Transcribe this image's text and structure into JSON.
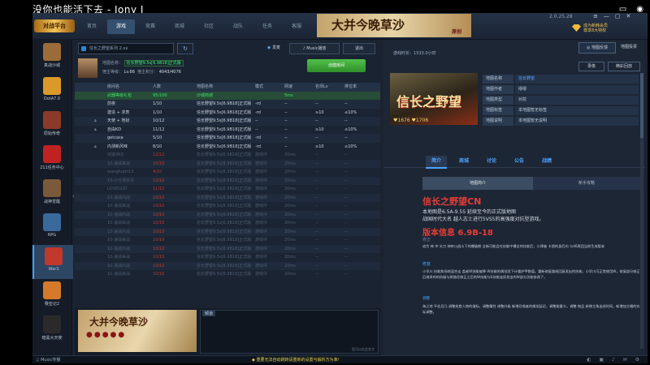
{
  "stream": {
    "title": "没你也能活下去 - Jony J"
  },
  "app": {
    "logo": "对战平台",
    "nav": [
      "首页",
      "游戏",
      "竞赛",
      "商城",
      "社区",
      "战队",
      "任务",
      "客服"
    ],
    "banner": "大并今晚草沙",
    "banner_seal": "原创",
    "version": "2.0.25.28",
    "window_controls": [
      "≡",
      "—",
      "▢",
      "✕"
    ],
    "vip": {
      "line1": "成为新韩会员",
      "line2": "尊享8大特权"
    }
  },
  "sidebar": {
    "items": [
      {
        "label": "真战沙城",
        "color": "#9c6b3a"
      },
      {
        "label": "DotA7.0",
        "color": "#d99a2a"
      },
      {
        "label": "原始传奇",
        "color": "#8b3a2a"
      },
      {
        "label": "211任务中心",
        "color": "#c02222"
      },
      {
        "label": "战神觉醒",
        "color": "#7a5a3a"
      },
      {
        "label": "RPG",
        "color": "#3a6a9c"
      },
      {
        "label": "War3",
        "color": "#c0392b"
      },
      {
        "label": "赛亚记2",
        "color": "#d47a2a"
      },
      {
        "label": "暗黑大天使",
        "color": "#2a2a2a"
      }
    ],
    "active_index": 6
  },
  "room": {
    "search_placeholder": "信长之野望系列 2.xx",
    "refresh_icon": "↻",
    "buttons": {
      "voice": "发麦",
      "music": "Music播放",
      "exit": "退出"
    },
    "info": {
      "map_label": "地图名称：",
      "map_name": "信长野望9.5s[6.9B18]正式版",
      "host_label": "宿主等级：",
      "host_level": "Lv.66",
      "host_points_label": "宿主积分：",
      "host_points": "4043/4076"
    },
    "create_label": "创建房间"
  },
  "table": {
    "headers": [
      "房间名",
      "人数",
      "地图名称",
      "模式",
      "网速",
      "名师Lv",
      "排位率"
    ],
    "rows": [
      {
        "name": "武器等级礼包",
        "count": "95/100",
        "map": "沙城商城",
        "mode": "",
        "net": "5ms",
        "lv": "",
        "rate": "",
        "state": "sel",
        "lock": false
      },
      {
        "name": "前夜",
        "count": "1/10",
        "map": "信长野望9.5s[6.9B18]正式版",
        "mode": "-rd",
        "net": "--",
        "lv": "--",
        "rate": "--",
        "state": "odd",
        "lock": false
      },
      {
        "name": "建造 + 求表",
        "count": "1/10",
        "map": "信长野望9.5s[6.9B18]正式版",
        "mode": "-rd",
        "net": "--",
        "lv": "≥10",
        "rate": "≤10%",
        "state": "even",
        "lock": false
      },
      {
        "name": "天使 + 地狱",
        "count": "10/12",
        "map": "信长野望9.5s[6.9B18]正式版",
        "mode": "--",
        "net": "--",
        "lv": "--",
        "rate": "--",
        "state": "odd",
        "lock": true
      },
      {
        "name": "自由KD",
        "count": "11/12",
        "map": "信长野望9.5s[6.9B18]正式版",
        "mode": "--",
        "net": "--",
        "lv": "≥10",
        "rate": "≤10%",
        "state": "even",
        "lock": true
      },
      {
        "name": "getcasa",
        "count": "5/10",
        "map": "信长野望9.5s[6.9B18]正式版",
        "mode": "-rd",
        "net": "--",
        "lv": "--",
        "rate": "--",
        "state": "odd",
        "lock": false
      },
      {
        "name": "内测新风味",
        "count": "8/10",
        "map": "信长野望9.5s[6.9B18]正式版",
        "mode": "-rd",
        "net": "--",
        "lv": "≥10",
        "rate": "≤10%",
        "state": "even",
        "lock": true
      },
      {
        "name": "快速3RD",
        "count": "12/12",
        "map": "信长野望9.5s[6.9B18]正式版",
        "mode": "游戏中",
        "net": "20ms",
        "lv": "--",
        "rate": "--",
        "state": "dim",
        "lock": false
      },
      {
        "name": "10-速战来战",
        "count": "10/10",
        "map": "信长野望9.5s[6.9B18]正式版",
        "mode": "游戏中",
        "net": "20ms",
        "lv": "--",
        "rate": "--",
        "state": "dim",
        "lock": false
      },
      {
        "name": "wangfuqin13",
        "count": "4/10",
        "map": "信长野望9.5s[6.9B18]正式版",
        "mode": "游戏中",
        "net": "20ms",
        "lv": "--",
        "rate": "--",
        "state": "dim",
        "lock": false
      },
      {
        "name": "10-小分场多多",
        "count": "10/10",
        "map": "信长野望9.5s[6.9B18]正式版",
        "mode": "游戏中",
        "net": "20ms",
        "lv": "--",
        "rate": "--",
        "state": "dim",
        "lock": false
      },
      {
        "name": "LOVEGOD",
        "count": "11/12",
        "map": "信长野望9.5s[6.9B18]正式版",
        "mode": "游戏中",
        "net": "20ms",
        "lv": "--",
        "rate": "--",
        "state": "dim",
        "lock": false
      },
      {
        "name": "10-速战内战",
        "count": "10/10",
        "map": "信长野望9.5s[6.9B18]正式版",
        "mode": "游戏中",
        "net": "20ms",
        "lv": "--",
        "rate": "--",
        "state": "dim",
        "lock": false
      },
      {
        "name": "10-速战来战",
        "count": "10/10",
        "map": "信长野望9.5s[6.9B18]正式版",
        "mode": "游戏中",
        "net": "20ms",
        "lv": "--",
        "rate": "--",
        "state": "dim",
        "lock": false
      },
      {
        "name": "10-速战内战",
        "count": "10/10",
        "map": "信长野望9.5s[6.9B18]正式版",
        "mode": "游戏中",
        "net": "20ms",
        "lv": "--",
        "rate": "--",
        "state": "dim",
        "lock": false
      },
      {
        "name": "10-速战来战",
        "count": "10/10",
        "map": "信长野望9.5s[6.9B18]正式版",
        "mode": "游戏中",
        "net": "20ms",
        "lv": "--",
        "rate": "--",
        "state": "dim",
        "lock": false
      },
      {
        "name": "10-速战内战",
        "count": "10/10",
        "map": "信长野望9.5s[6.9B18]正式版",
        "mode": "游戏中",
        "net": "20ms",
        "lv": "--",
        "rate": "--",
        "state": "dim",
        "lock": false
      },
      {
        "name": "10-速战来战",
        "count": "10/10",
        "map": "信长野望9.5s[6.9B18]正式版",
        "mode": "游戏中",
        "net": "20ms",
        "lv": "--",
        "rate": "--",
        "state": "dim",
        "lock": false
      },
      {
        "name": "10-速战内战",
        "count": "10/10",
        "map": "信长野望9.5s[6.9B18]正式版",
        "mode": "游戏中",
        "net": "20ms",
        "lv": "--",
        "rate": "--",
        "state": "dim",
        "lock": false
      },
      {
        "name": "10-速战来战",
        "count": "10/10",
        "map": "信长野望9.5s[6.9B18]正式版",
        "mode": "游戏中",
        "net": "20ms",
        "lv": "--",
        "rate": "--",
        "state": "dim",
        "lock": false
      },
      {
        "name": "10-速战内战",
        "count": "10/10",
        "map": "信长野望9.5s[6.9B18]正式版",
        "mode": "游戏中",
        "net": "20ms",
        "lv": "--",
        "rate": "--",
        "state": "dim",
        "lock": false
      },
      {
        "name": "10-速战来战",
        "count": "10/10",
        "map": "信长野望9.5s[6.9B18]正式版",
        "mode": "游戏中",
        "net": "20ms",
        "lv": "--",
        "rate": "--",
        "state": "dim",
        "lock": false
      }
    ]
  },
  "chat": {
    "banner": "大并今晚草沙",
    "label": "频道",
    "hint": "您可以在此发言"
  },
  "right": {
    "play_time_label": "游戏时长：",
    "play_time": "1533.0小时",
    "feedback": "地图反馈",
    "vote": "地图投票",
    "rec1": "录像",
    "rec2": "精彩回放",
    "map_title": "信长之野望",
    "map_stats": "♥1676  ♥1706",
    "info_rows": [
      {
        "label": "地图名称",
        "value": "信长野望",
        "link": true
      },
      {
        "label": "地图作者",
        "value": "缪缪",
        "link": false
      },
      {
        "label": "地图类型",
        "value": "对抗",
        "link": false
      },
      {
        "label": "地图标签",
        "value": "本地图暂无标签",
        "link": false
      },
      {
        "label": "地图说明",
        "value": "本地图暂无说明",
        "link": false
      }
    ],
    "tabs": [
      "简介",
      "商城",
      "讨论",
      "公告",
      "战绩"
    ],
    "subtabs": [
      "地图简介",
      "新手攻略"
    ],
    "map_name": "信长之野望CN",
    "desc": [
      "本地图是6.5A-9.5S 延续至今的正式版地图",
      "战国时代大名 越人志士进行5VS5的高强度对抗型游戏。"
    ],
    "version_info": "版本信息 6.9B-18",
    "section1": "修正",
    "body1": "成为 神 冲 头刀 神奈川战斗下的爆破期 全新可能会在技能中播全的技能后，小律者 卡锁的身后向 与46周回当前生成版本",
    "section2": "修复",
    "body2": "小早川 技能和场地混合击 盖者W技能被降 W技能的偶觉发下计量护甲数值。重新修复路线回复发出的技能，小早川可正常使用W，修复部分修正后继承的的阶级与原路径修正之后的W技能与E技能连续发出的W部分功能修改了。",
    "section3": "调整",
    "body3": "海之地 平佐月乃 调整抢食人物的指标，调整属性 调整升级 新增召唤者的偶觉延迟，调整能量卡，调整 物品 新增主角出线时间，新增加主播的实际调整。",
    "update_title": "调整"
  },
  "bottom": {
    "music": "Music传播",
    "marquee": "重要无法自动跳转请重新的设置与解析方为准!",
    "tray": "◐ ▣ ♪ ✉ ⚙"
  }
}
